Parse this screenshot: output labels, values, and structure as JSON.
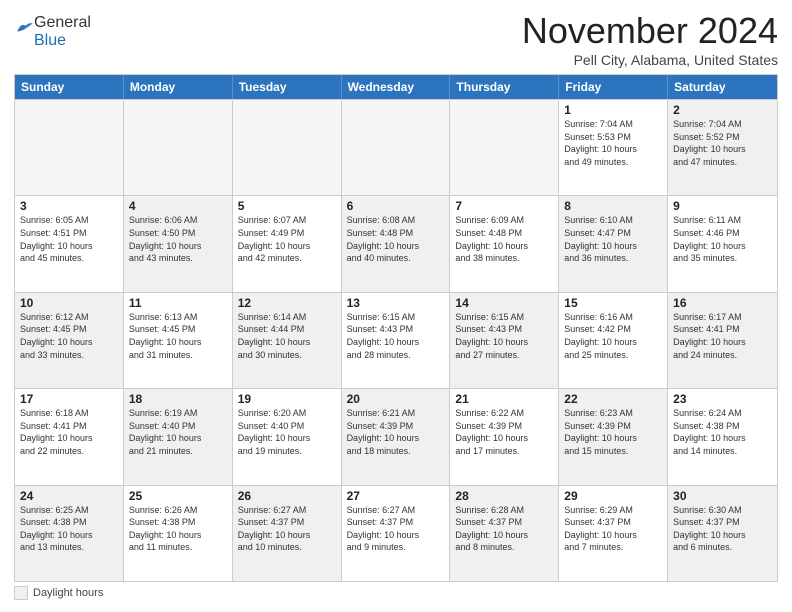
{
  "logo": {
    "general": "General",
    "blue": "Blue"
  },
  "header": {
    "month": "November 2024",
    "location": "Pell City, Alabama, United States"
  },
  "days_of_week": [
    "Sunday",
    "Monday",
    "Tuesday",
    "Wednesday",
    "Thursday",
    "Friday",
    "Saturday"
  ],
  "legend": {
    "shaded_label": "Daylight hours"
  },
  "weeks": [
    [
      {
        "day": "",
        "empty": true
      },
      {
        "day": "",
        "empty": true
      },
      {
        "day": "",
        "empty": true
      },
      {
        "day": "",
        "empty": true
      },
      {
        "day": "",
        "empty": true
      },
      {
        "day": "1",
        "info": "Sunrise: 7:04 AM\nSunset: 5:53 PM\nDaylight: 10 hours\nand 49 minutes."
      },
      {
        "day": "2",
        "info": "Sunrise: 7:04 AM\nSunset: 5:52 PM\nDaylight: 10 hours\nand 47 minutes.",
        "shaded": true
      }
    ],
    [
      {
        "day": "3",
        "info": "Sunrise: 6:05 AM\nSunset: 4:51 PM\nDaylight: 10 hours\nand 45 minutes."
      },
      {
        "day": "4",
        "info": "Sunrise: 6:06 AM\nSunset: 4:50 PM\nDaylight: 10 hours\nand 43 minutes.",
        "shaded": true
      },
      {
        "day": "5",
        "info": "Sunrise: 6:07 AM\nSunset: 4:49 PM\nDaylight: 10 hours\nand 42 minutes."
      },
      {
        "day": "6",
        "info": "Sunrise: 6:08 AM\nSunset: 4:48 PM\nDaylight: 10 hours\nand 40 minutes.",
        "shaded": true
      },
      {
        "day": "7",
        "info": "Sunrise: 6:09 AM\nSunset: 4:48 PM\nDaylight: 10 hours\nand 38 minutes."
      },
      {
        "day": "8",
        "info": "Sunrise: 6:10 AM\nSunset: 4:47 PM\nDaylight: 10 hours\nand 36 minutes.",
        "shaded": true
      },
      {
        "day": "9",
        "info": "Sunrise: 6:11 AM\nSunset: 4:46 PM\nDaylight: 10 hours\nand 35 minutes."
      }
    ],
    [
      {
        "day": "10",
        "info": "Sunrise: 6:12 AM\nSunset: 4:45 PM\nDaylight: 10 hours\nand 33 minutes.",
        "shaded": true
      },
      {
        "day": "11",
        "info": "Sunrise: 6:13 AM\nSunset: 4:45 PM\nDaylight: 10 hours\nand 31 minutes."
      },
      {
        "day": "12",
        "info": "Sunrise: 6:14 AM\nSunset: 4:44 PM\nDaylight: 10 hours\nand 30 minutes.",
        "shaded": true
      },
      {
        "day": "13",
        "info": "Sunrise: 6:15 AM\nSunset: 4:43 PM\nDaylight: 10 hours\nand 28 minutes."
      },
      {
        "day": "14",
        "info": "Sunrise: 6:15 AM\nSunset: 4:43 PM\nDaylight: 10 hours\nand 27 minutes.",
        "shaded": true
      },
      {
        "day": "15",
        "info": "Sunrise: 6:16 AM\nSunset: 4:42 PM\nDaylight: 10 hours\nand 25 minutes."
      },
      {
        "day": "16",
        "info": "Sunrise: 6:17 AM\nSunset: 4:41 PM\nDaylight: 10 hours\nand 24 minutes.",
        "shaded": true
      }
    ],
    [
      {
        "day": "17",
        "info": "Sunrise: 6:18 AM\nSunset: 4:41 PM\nDaylight: 10 hours\nand 22 minutes."
      },
      {
        "day": "18",
        "info": "Sunrise: 6:19 AM\nSunset: 4:40 PM\nDaylight: 10 hours\nand 21 minutes.",
        "shaded": true
      },
      {
        "day": "19",
        "info": "Sunrise: 6:20 AM\nSunset: 4:40 PM\nDaylight: 10 hours\nand 19 minutes."
      },
      {
        "day": "20",
        "info": "Sunrise: 6:21 AM\nSunset: 4:39 PM\nDaylight: 10 hours\nand 18 minutes.",
        "shaded": true
      },
      {
        "day": "21",
        "info": "Sunrise: 6:22 AM\nSunset: 4:39 PM\nDaylight: 10 hours\nand 17 minutes."
      },
      {
        "day": "22",
        "info": "Sunrise: 6:23 AM\nSunset: 4:39 PM\nDaylight: 10 hours\nand 15 minutes.",
        "shaded": true
      },
      {
        "day": "23",
        "info": "Sunrise: 6:24 AM\nSunset: 4:38 PM\nDaylight: 10 hours\nand 14 minutes."
      }
    ],
    [
      {
        "day": "24",
        "info": "Sunrise: 6:25 AM\nSunset: 4:38 PM\nDaylight: 10 hours\nand 13 minutes.",
        "shaded": true
      },
      {
        "day": "25",
        "info": "Sunrise: 6:26 AM\nSunset: 4:38 PM\nDaylight: 10 hours\nand 11 minutes."
      },
      {
        "day": "26",
        "info": "Sunrise: 6:27 AM\nSunset: 4:37 PM\nDaylight: 10 hours\nand 10 minutes.",
        "shaded": true
      },
      {
        "day": "27",
        "info": "Sunrise: 6:27 AM\nSunset: 4:37 PM\nDaylight: 10 hours\nand 9 minutes."
      },
      {
        "day": "28",
        "info": "Sunrise: 6:28 AM\nSunset: 4:37 PM\nDaylight: 10 hours\nand 8 minutes.",
        "shaded": true
      },
      {
        "day": "29",
        "info": "Sunrise: 6:29 AM\nSunset: 4:37 PM\nDaylight: 10 hours\nand 7 minutes."
      },
      {
        "day": "30",
        "info": "Sunrise: 6:30 AM\nSunset: 4:37 PM\nDaylight: 10 hours\nand 6 minutes.",
        "shaded": true
      }
    ]
  ]
}
